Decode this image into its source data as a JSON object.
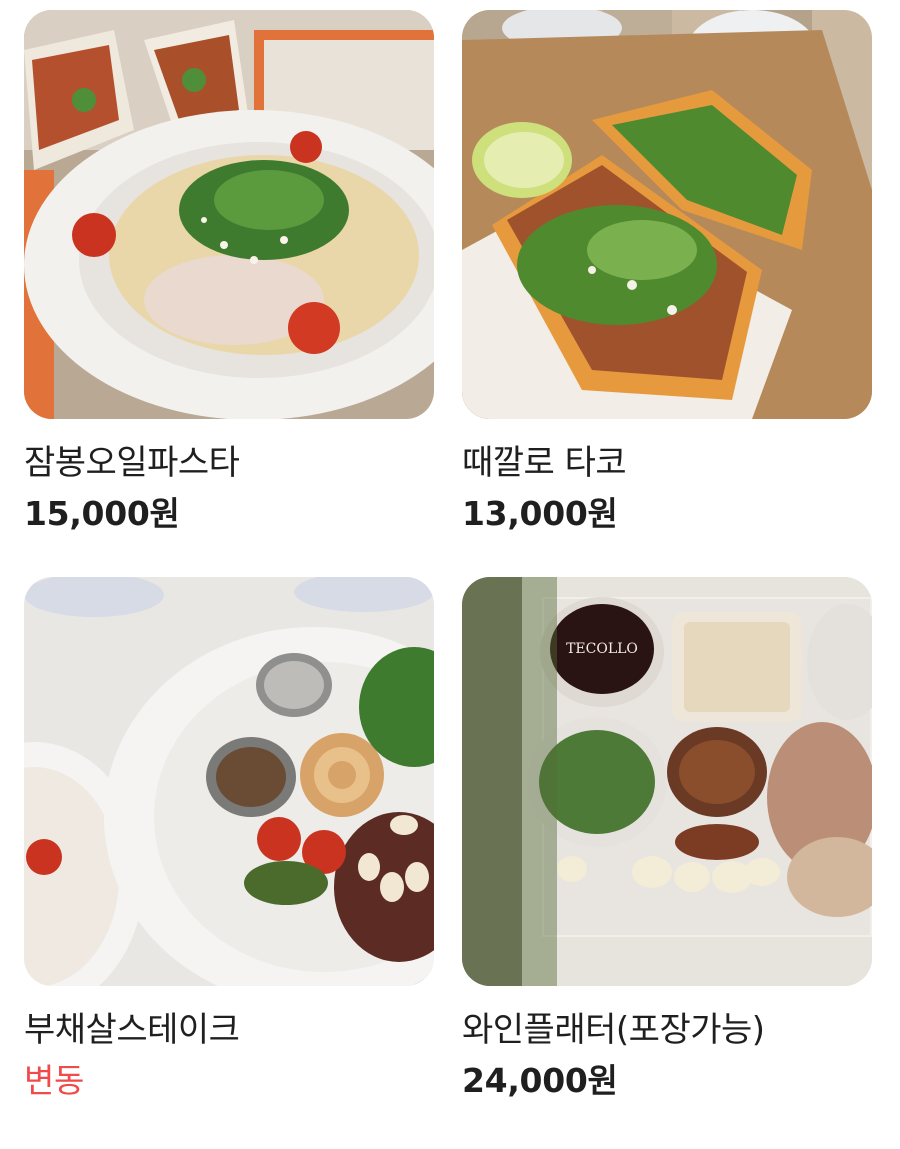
{
  "menu": {
    "items": [
      {
        "name": "잠봉오일파스타",
        "price": "15,000원",
        "price_state": "normal",
        "photo_icon": "pasta-photo"
      },
      {
        "name": "때깔로 타코",
        "price": "13,000원",
        "price_state": "normal",
        "photo_icon": "taco-photo"
      },
      {
        "name": "부채살스테이크",
        "price": "변동",
        "price_state": "variable",
        "photo_icon": "steak-photo"
      },
      {
        "name": "와인플래터(포장가능)",
        "price": "24,000원",
        "price_state": "normal",
        "photo_icon": "wine-platter-photo"
      }
    ]
  },
  "photo_labels": {
    "wine_platter_cup_text": "TECOLLO"
  },
  "colors": {
    "text": "#1f1f1f",
    "variable_price": "#f04a4a",
    "background": "#ffffff"
  }
}
